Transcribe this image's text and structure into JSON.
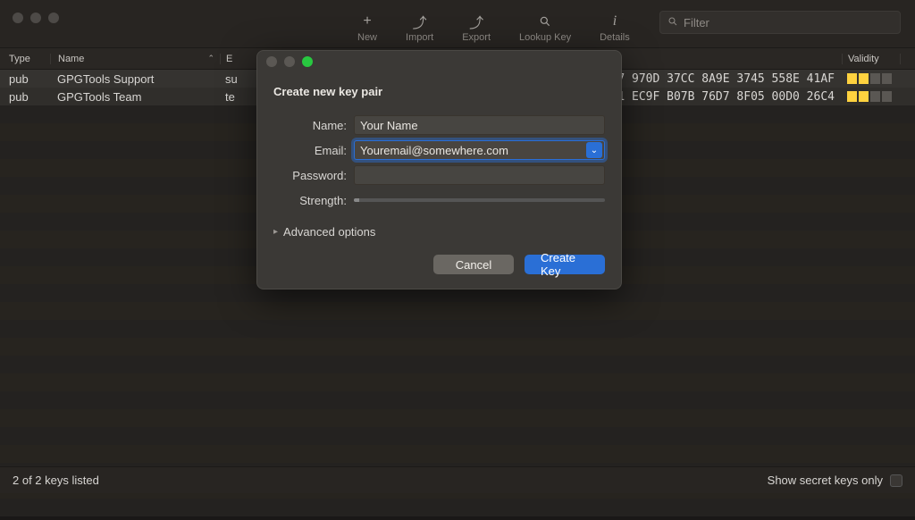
{
  "toolbar": {
    "new": {
      "label": "New",
      "icon": "+"
    },
    "import": {
      "label": "Import",
      "icon": "⤴"
    },
    "export": {
      "label": "Export",
      "icon": "⤴"
    },
    "lookup": {
      "label": "Lookup Key",
      "icon": "🔍"
    },
    "details": {
      "label": "Details",
      "icon": "ⓘ"
    }
  },
  "search": {
    "placeholder": "Filter"
  },
  "columns": {
    "type": "Type",
    "name": "Name",
    "e": "E",
    "validity": "Validity"
  },
  "rows": [
    {
      "type": "pub",
      "name": "GPGTools Support",
      "e": "su",
      "fpr_tail": "7 970D  37CC 8A9E 3745 558E 41AF"
    },
    {
      "type": "pub",
      "name": "GPGTools Team",
      "e": "te",
      "fpr_tail": "1 EC9F  B07B 76D7 8F05 00D0 26C4"
    }
  ],
  "footer": {
    "status": "2 of 2 keys listed",
    "secret_label": "Show secret keys only"
  },
  "dialog": {
    "title": "Create new key pair",
    "name_label": "Name:",
    "name_value": "Your Name",
    "email_label": "Email:",
    "email_value": "Youremail@somewhere.com",
    "password_label": "Password:",
    "strength_label": "Strength:",
    "advanced": "Advanced options",
    "cancel": "Cancel",
    "create": "Create Key"
  }
}
